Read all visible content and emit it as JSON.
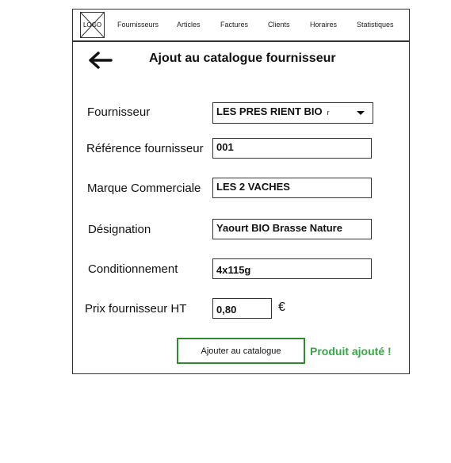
{
  "logo": {
    "text": "LOGO"
  },
  "nav": {
    "items": [
      "Fournisseurs",
      "Articles",
      "Factures",
      "Clients",
      "Horaires",
      "Statistiques"
    ]
  },
  "header": {
    "title": "Ajout au catalogue fournisseur"
  },
  "form": {
    "fournisseur": {
      "label": "Fournisseur",
      "value": "LES PRES RIENT BIO",
      "mark": "r"
    },
    "reference": {
      "label": "Référence fournisseur",
      "value": "001"
    },
    "marque": {
      "label": "Marque Commerciale",
      "value": "LES 2 VACHES"
    },
    "designation": {
      "label": "Désignation",
      "value": "Yaourt BIO Brasse Nature"
    },
    "conditionnement": {
      "label": "Conditionnement",
      "value": "4x115g"
    },
    "prix": {
      "label": "Prix fournisseur HT",
      "value": "0,80",
      "currency": "€"
    }
  },
  "actions": {
    "add_label": "Ajouter au catalogue"
  },
  "status": {
    "message": "Produit ajouté !",
    "color": "#35a845"
  },
  "colors": {
    "button_border": "#2e8b2e"
  }
}
